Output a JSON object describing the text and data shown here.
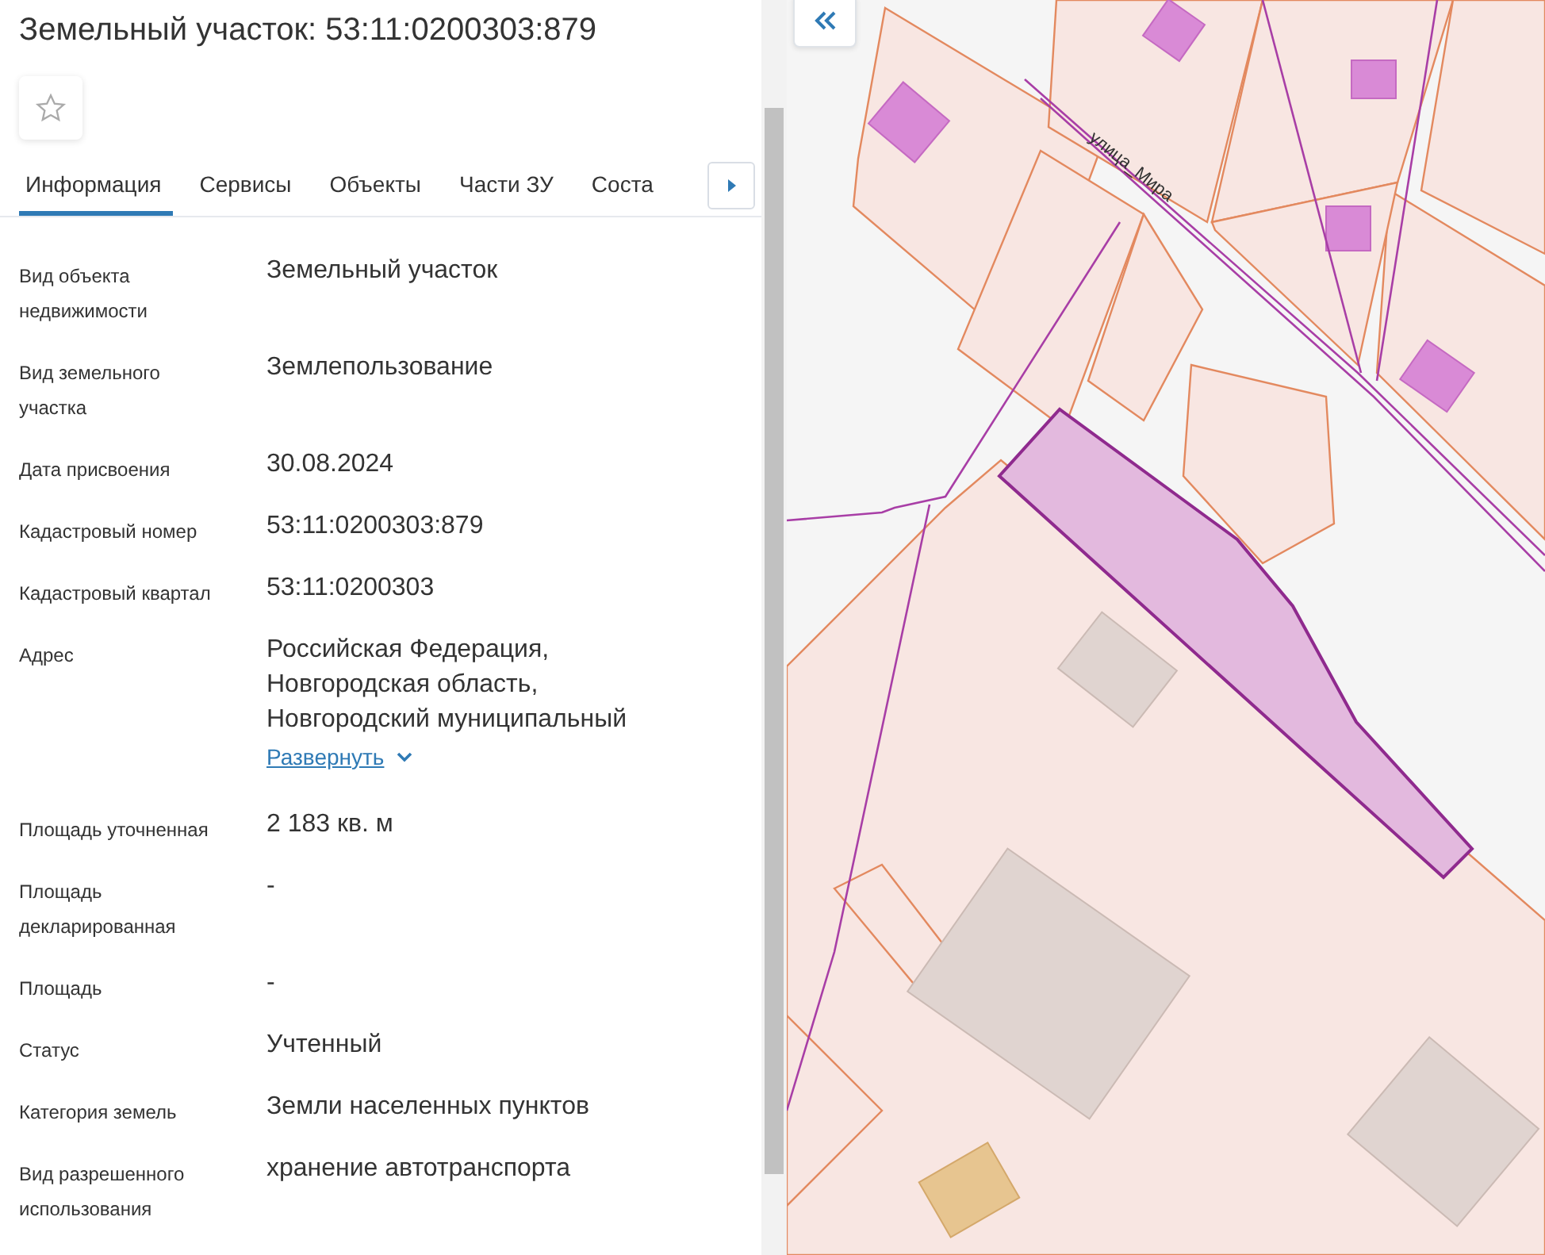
{
  "title": "Земельный участок: 53:11:0200303:879",
  "favorite": {
    "on": false
  },
  "tabs": [
    {
      "label": "Информация",
      "selected": true
    },
    {
      "label": "Сервисы",
      "selected": false
    },
    {
      "label": "Объекты",
      "selected": false
    },
    {
      "label": "Части ЗУ",
      "selected": false
    },
    {
      "label": "Соста",
      "selected": false
    }
  ],
  "rows": [
    {
      "kind": "text",
      "label": "Вид объекта недвижимости",
      "value": "Земельный участок"
    },
    {
      "kind": "text",
      "label": "Вид земельного участка",
      "value": "Землепользование"
    },
    {
      "kind": "text",
      "label": "Дата присвоения",
      "value": "30.08.2024"
    },
    {
      "kind": "text",
      "label": "Кадастровый номер",
      "value": "53:11:0200303:879"
    },
    {
      "kind": "text",
      "label": "Кадастровый квартал",
      "value": "53:11:0200303"
    },
    {
      "kind": "expandable",
      "label": "Адрес",
      "lines": [
        "Российская Федерация,",
        "Новгородская область,",
        "Новгородский муниципальный"
      ],
      "expand_label": "Развернуть"
    },
    {
      "kind": "text",
      "label": "Площадь уточненная",
      "value": "2 183 кв. м"
    },
    {
      "kind": "text",
      "label": "Площадь декларированная",
      "value": "-"
    },
    {
      "kind": "text",
      "label": "Площадь",
      "value": "-"
    },
    {
      "kind": "text",
      "label": "Статус",
      "value": "Учтенный"
    },
    {
      "kind": "text",
      "label": "Категория земель",
      "value": "Земли населенных пунктов"
    },
    {
      "kind": "text",
      "label": "Вид разрешенного использования",
      "value": "хранение автотранспорта"
    }
  ],
  "map": {
    "street_label": "улица_Мира"
  }
}
